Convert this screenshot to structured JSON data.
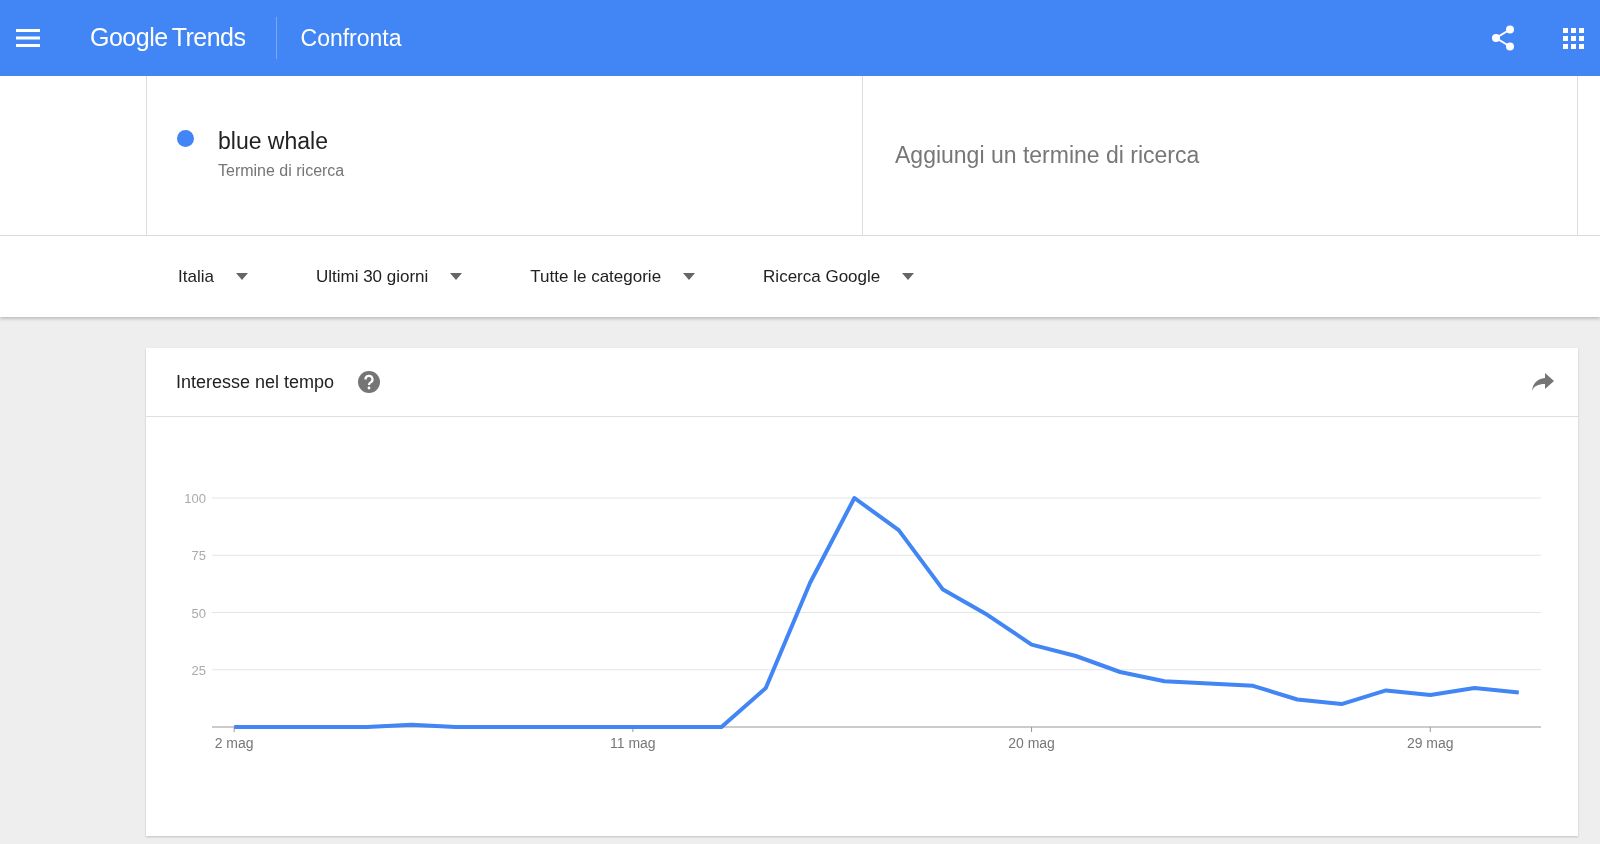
{
  "header": {
    "logo": {
      "word_1": "Google",
      "word_2": "Trends"
    },
    "title": "Confronta"
  },
  "terms": [
    {
      "name": "blue whale",
      "subtitle": "Termine di ricerca",
      "color": "#4285f4"
    }
  ],
  "add_term": {
    "placeholder": "Aggiungi un termine di ricerca"
  },
  "filters": [
    {
      "label": "Italia"
    },
    {
      "label": "Ultimi 30 giorni"
    },
    {
      "label": "Tutte le categorie"
    },
    {
      "label": "Ricerca Google"
    }
  ],
  "interest_card": {
    "title": "Interesse nel tempo",
    "chart_data": {
      "type": "line",
      "x": [
        2,
        3,
        4,
        5,
        6,
        7,
        8,
        9,
        10,
        11,
        12,
        13,
        14,
        15,
        16,
        17,
        18,
        19,
        20,
        21,
        22,
        23,
        24,
        25,
        26,
        27,
        28,
        29,
        30,
        31
      ],
      "series": [
        {
          "color": "#4285f4",
          "values": [
            0,
            0,
            0,
            0,
            1,
            0,
            0,
            0,
            0,
            0,
            0,
            0,
            17,
            63,
            100,
            86,
            60,
            49,
            36,
            31,
            24,
            20,
            19,
            18,
            12,
            10,
            16,
            14,
            17,
            15
          ]
        }
      ],
      "xlim": [
        1.5,
        31.5
      ],
      "ylim": [
        0,
        100
      ],
      "grid": true,
      "yticks": [
        25,
        50,
        75,
        100
      ],
      "xticks": [
        {
          "value": 2,
          "label": "2 mag"
        },
        {
          "value": 11,
          "label": "11 mag"
        },
        {
          "value": 20,
          "label": "20 mag"
        },
        {
          "value": 29,
          "label": "29 mag"
        }
      ]
    }
  }
}
